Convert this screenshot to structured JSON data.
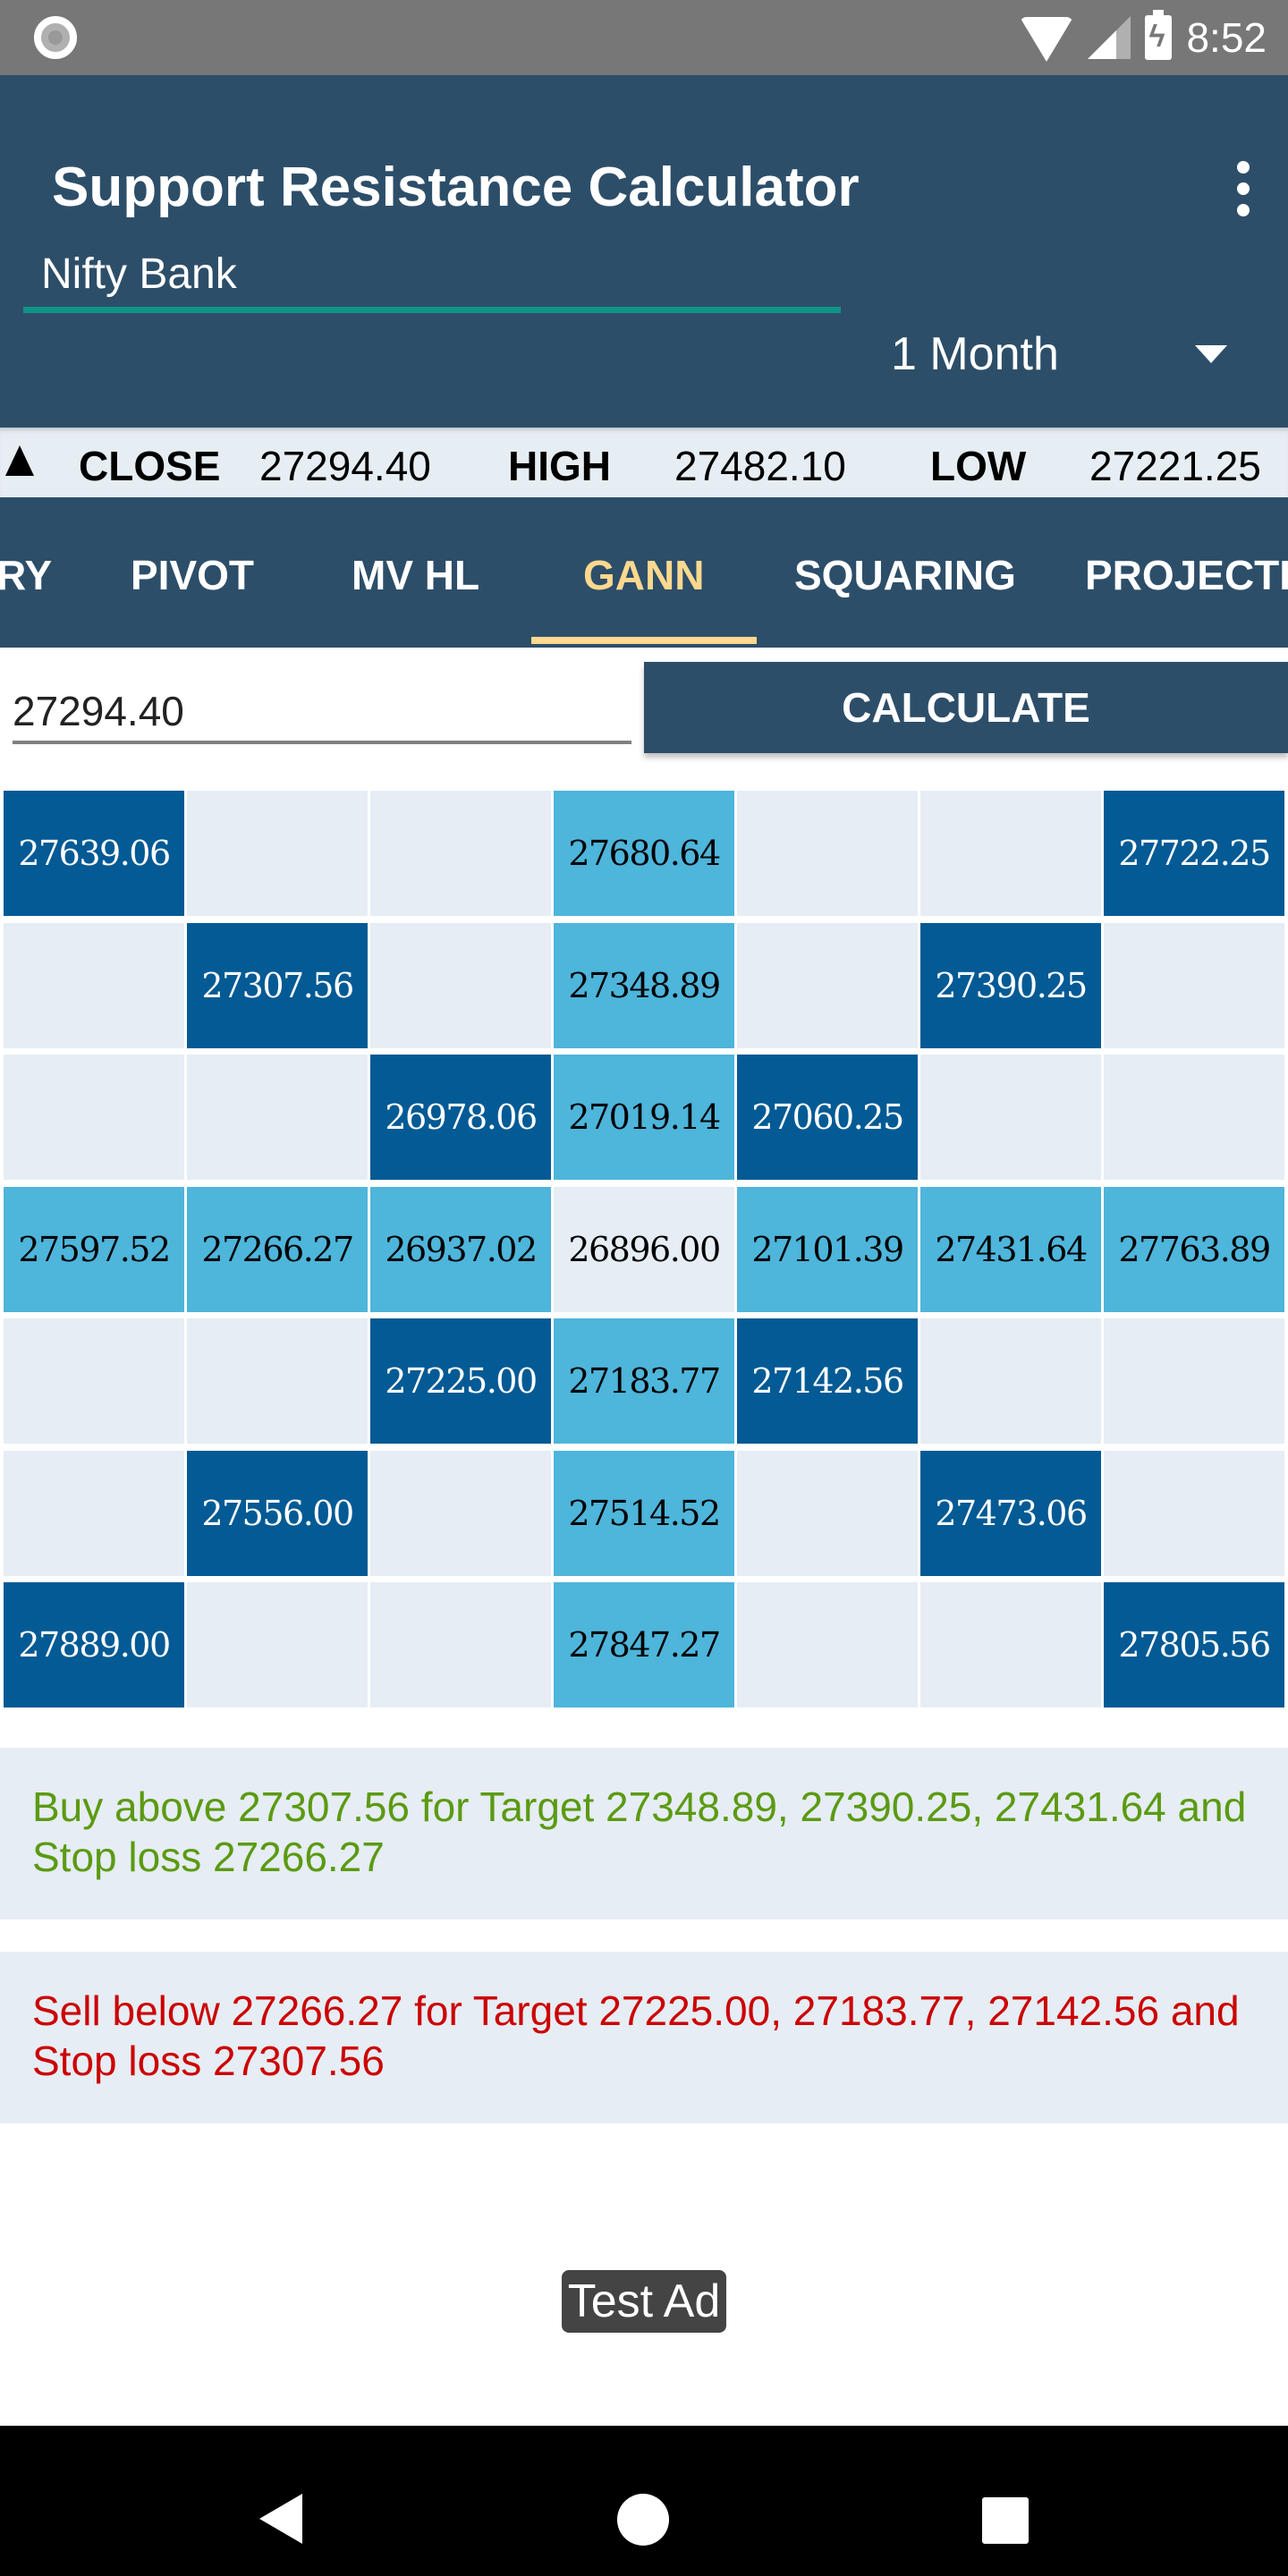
{
  "status_bar": {
    "time": "8:52",
    "icons": [
      "notification-circle-icon",
      "wifi-icon",
      "cell-signal-icon",
      "battery-charging-icon"
    ]
  },
  "app_bar": {
    "title": "Support Resistance Calculator",
    "menu_icon": "overflow-menu-icon",
    "symbol_input": {
      "value": "Nifty Bank",
      "placeholder": ""
    },
    "period_select": {
      "selected": "1 Month"
    }
  },
  "quote": {
    "trend_icon": "up-triangle-icon",
    "close_label": "CLOSE",
    "close_value": "27294.40",
    "high_label": "HIGH",
    "high_value": "27482.10",
    "low_label": "LOW",
    "low_value": "27221.25"
  },
  "tabs": [
    {
      "label": "RY",
      "active": false
    },
    {
      "label": "PIVOT",
      "active": false
    },
    {
      "label": "MV HL",
      "active": false
    },
    {
      "label": "GANN",
      "active": true
    },
    {
      "label": "SQUARING",
      "active": false
    },
    {
      "label": "PROJECTI",
      "active": false
    }
  ],
  "calculator": {
    "price_input": {
      "value": "27294.40"
    },
    "calculate_label": "CALCULATE"
  },
  "colors": {
    "app_bar": "#2d4e69",
    "tab_active": "#fdd88f",
    "accent": "#0e9486",
    "cell_dark": "#035a94",
    "cell_light": "#4eb5db",
    "cell_empty": "#e6edf4",
    "buy_text": "#5b9a12",
    "sell_text": "#cc0000"
  },
  "gann_grid": {
    "rows": [
      [
        {
          "v": "27639.06",
          "t": "dark"
        },
        {
          "v": "",
          "t": "empty"
        },
        {
          "v": "",
          "t": "empty"
        },
        {
          "v": "27680.64",
          "t": "light"
        },
        {
          "v": "",
          "t": "empty"
        },
        {
          "v": "",
          "t": "empty"
        },
        {
          "v": "27722.25",
          "t": "dark"
        }
      ],
      [
        {
          "v": "",
          "t": "empty"
        },
        {
          "v": "27307.56",
          "t": "dark"
        },
        {
          "v": "",
          "t": "empty"
        },
        {
          "v": "27348.89",
          "t": "light"
        },
        {
          "v": "",
          "t": "empty"
        },
        {
          "v": "27390.25",
          "t": "dark"
        },
        {
          "v": "",
          "t": "empty"
        }
      ],
      [
        {
          "v": "",
          "t": "empty"
        },
        {
          "v": "",
          "t": "empty"
        },
        {
          "v": "26978.06",
          "t": "dark"
        },
        {
          "v": "27019.14",
          "t": "light"
        },
        {
          "v": "27060.25",
          "t": "dark"
        },
        {
          "v": "",
          "t": "empty"
        },
        {
          "v": "",
          "t": "empty"
        }
      ],
      [
        {
          "v": "27597.52",
          "t": "light"
        },
        {
          "v": "27266.27",
          "t": "light"
        },
        {
          "v": "26937.02",
          "t": "light"
        },
        {
          "v": "26896.00",
          "t": "empty"
        },
        {
          "v": "27101.39",
          "t": "light"
        },
        {
          "v": "27431.64",
          "t": "light"
        },
        {
          "v": "27763.89",
          "t": "light"
        }
      ],
      [
        {
          "v": "",
          "t": "empty"
        },
        {
          "v": "",
          "t": "empty"
        },
        {
          "v": "27225.00",
          "t": "dark"
        },
        {
          "v": "27183.77",
          "t": "light"
        },
        {
          "v": "27142.56",
          "t": "dark"
        },
        {
          "v": "",
          "t": "empty"
        },
        {
          "v": "",
          "t": "empty"
        }
      ],
      [
        {
          "v": "",
          "t": "empty"
        },
        {
          "v": "27556.00",
          "t": "dark"
        },
        {
          "v": "",
          "t": "empty"
        },
        {
          "v": "27514.52",
          "t": "light"
        },
        {
          "v": "",
          "t": "empty"
        },
        {
          "v": "27473.06",
          "t": "dark"
        },
        {
          "v": "",
          "t": "empty"
        }
      ],
      [
        {
          "v": "27889.00",
          "t": "dark"
        },
        {
          "v": "",
          "t": "empty"
        },
        {
          "v": "",
          "t": "empty"
        },
        {
          "v": "27847.27",
          "t": "light"
        },
        {
          "v": "",
          "t": "empty"
        },
        {
          "v": "",
          "t": "empty"
        },
        {
          "v": "27805.56",
          "t": "dark"
        }
      ]
    ]
  },
  "signals": {
    "buy": "Buy above 27307.56 for Target 27348.89, 27390.25, 27431.64 and Stop loss 27266.27",
    "sell": "Sell below 27266.27 for Target 27225.00, 27183.77, 27142.56 and Stop loss 27307.56"
  },
  "ad": {
    "label": "Test Ad"
  },
  "nav_bar": {
    "icons": [
      "back-icon",
      "home-icon",
      "recents-icon"
    ]
  }
}
